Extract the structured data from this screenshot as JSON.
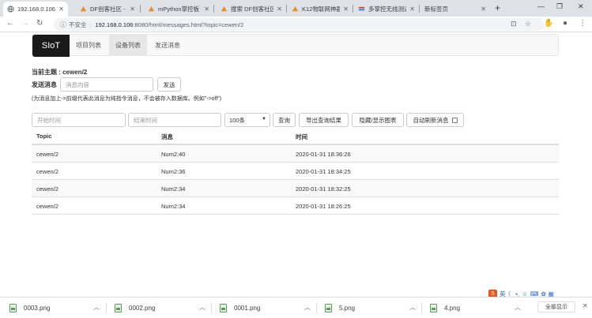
{
  "browser": {
    "tabs": [
      {
        "title": "192.168.0.106:",
        "active": true
      },
      {
        "title": "DF创客社区 - 分"
      },
      {
        "title": "mPython掌控板"
      },
      {
        "title": "搜索 DF创客社区"
      },
      {
        "title": "K12物联网神器"
      },
      {
        "title": "多掌控无线测温"
      },
      {
        "title": "新标签页"
      }
    ],
    "url_insecure": "不安全",
    "url_host": "192.168.0.106",
    "url_path": ":8080/html/messages.html?topic=cewen/2"
  },
  "nav": {
    "brand": "SIoT",
    "links": [
      "项目列表",
      "设备列表",
      "发送消息"
    ]
  },
  "topic": {
    "text": "当前主题 : cewen/2"
  },
  "send": {
    "label": "发送消息",
    "placeholder": "消息内容",
    "button": "发送",
    "hint": "(为消息加上->前缀代表此消息为纯指令消息，不会被存入数据库。例如\"->off\")"
  },
  "query": {
    "start_placeholder": "开始时间",
    "end_placeholder": "结束时间",
    "limit": "100条",
    "query_button": "查询",
    "export_button": "导出查询结果",
    "chart_button": "隐藏/显示图表",
    "auto_refresh": "自动刷新消息"
  },
  "table": {
    "headers": [
      "Topic",
      "消息",
      "时间"
    ],
    "rows": [
      [
        "cewen/2",
        "Num2:40",
        "2020-01-31 18:36:26"
      ],
      [
        "cewen/2",
        "Num2:36",
        "2020-01-31 18:34:25"
      ],
      [
        "cewen/2",
        "Num2:34",
        "2020-01-31 18:32:25"
      ],
      [
        "cewen/2",
        "Num2:34",
        "2020-01-31 18:26:25"
      ]
    ]
  },
  "downloads": {
    "items": [
      "0003.png",
      "0002.png",
      "0001.png",
      "5.png",
      "4.png"
    ],
    "show_all": "全部显示"
  },
  "ime": {
    "lang": "英"
  }
}
